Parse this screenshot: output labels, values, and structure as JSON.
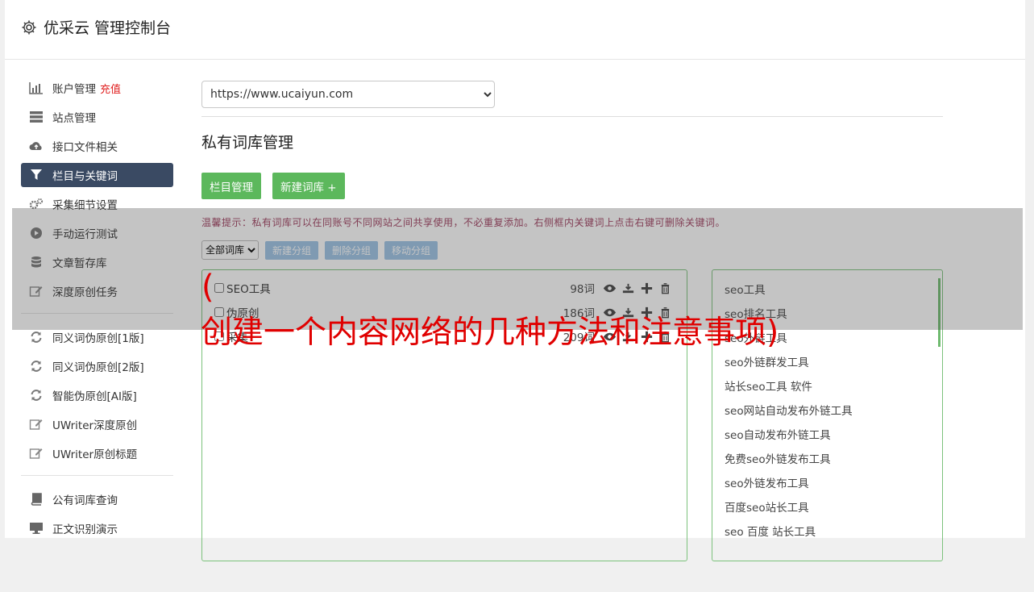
{
  "app": {
    "title": "优采云 管理控制台"
  },
  "sidebar": {
    "group1": [
      {
        "label": "账户管理",
        "badge": "充值",
        "icon": "bar-chart-icon"
      },
      {
        "label": "站点管理",
        "icon": "server-icon"
      },
      {
        "label": "接口文件相关",
        "icon": "cloud-upload-icon"
      },
      {
        "label": "栏目与关键词",
        "icon": "filter-icon",
        "active": true
      },
      {
        "label": "采集细节设置",
        "icon": "gears-icon"
      },
      {
        "label": "手动运行测试",
        "icon": "play-circle-icon"
      },
      {
        "label": "文章暂存库",
        "icon": "database-icon"
      },
      {
        "label": "深度原创任务",
        "icon": "edit-icon"
      }
    ],
    "group2": [
      {
        "label": "同义词伪原创[1版]",
        "icon": "refresh-icon"
      },
      {
        "label": "同义词伪原创[2版]",
        "icon": "refresh-icon"
      },
      {
        "label": "智能伪原创[AI版]",
        "icon": "refresh-icon"
      },
      {
        "label": "UWriter深度原创",
        "icon": "edit-icon"
      },
      {
        "label": "UWriter原创标题",
        "icon": "edit-icon"
      }
    ],
    "group3": [
      {
        "label": "公有词库查询",
        "icon": "book-icon"
      },
      {
        "label": "正文识别演示",
        "icon": "desktop-icon"
      }
    ]
  },
  "main": {
    "site_select": "https://www.ucaiyun.com",
    "page_title": "私有词库管理",
    "btn_columns": "栏目管理",
    "btn_new_lib": "新建词库 +",
    "tip": "温馨提示：私有词库可以在同账号不同网站之间共享使用，不必重复添加。右侧框内关键词上点击右键可删除关键词。",
    "filter_select": "全部词库",
    "btn_new_group": "新建分组",
    "btn_delete_group": "删除分组",
    "btn_move_group": "移动分组",
    "libraries": [
      {
        "name": "SEO工具",
        "count": "98词"
      },
      {
        "name": "伪原创",
        "count": "186词"
      },
      {
        "name": "采集",
        "count": "209词"
      }
    ],
    "keywords": [
      "seo工具",
      "seo排名工具",
      "seo外链工具",
      "seo外链群发工具",
      "站长seo工具 软件",
      "seo网站自动发布外链工具",
      "seo自动发布外链工具",
      "免费seo外链发布工具",
      "seo外链发布工具",
      "百度seo站长工具",
      "seo 百度 站长工具"
    ]
  },
  "overlay": {
    "paren": "(",
    "headline": "创建一个内容网络的几种方法和注意事项)"
  }
}
